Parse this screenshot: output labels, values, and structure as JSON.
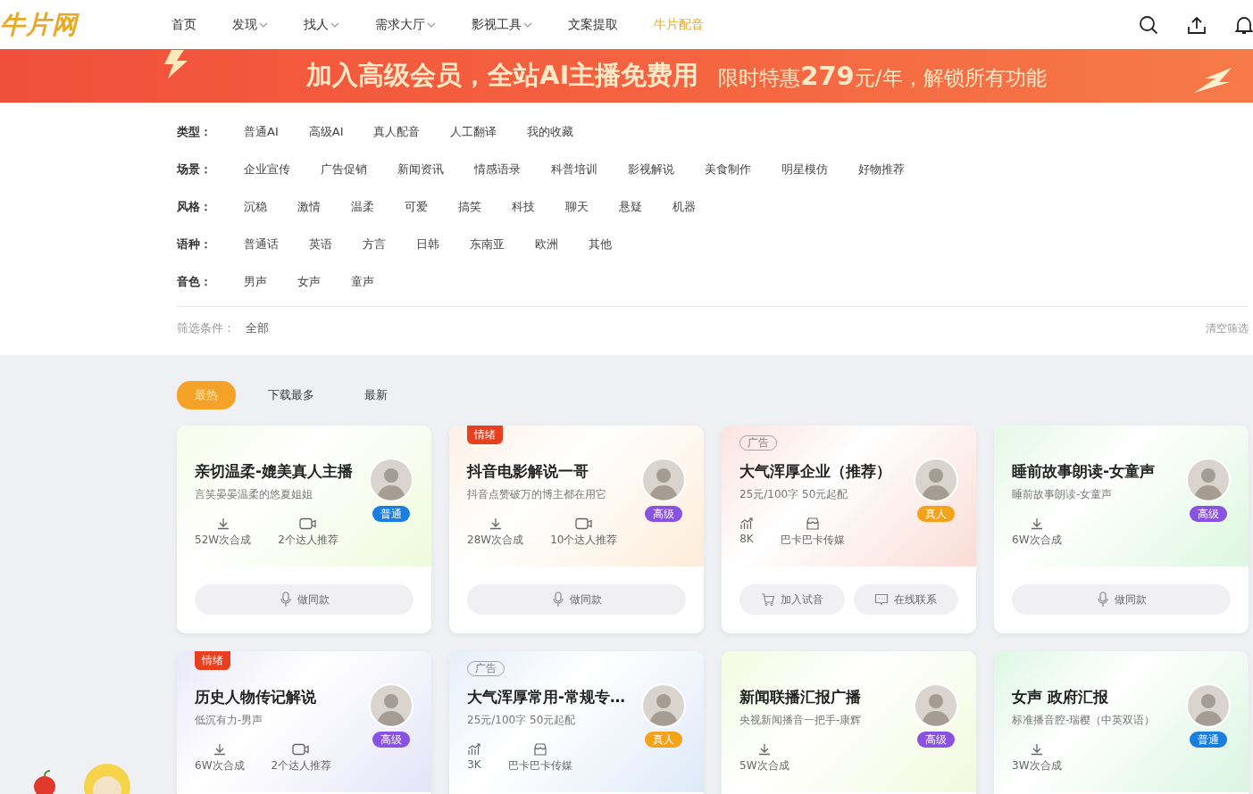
{
  "header": {
    "logo": "牛片网",
    "nav": [
      {
        "label": "首页",
        "dropdown": false,
        "selected": false
      },
      {
        "label": "发现",
        "dropdown": true,
        "selected": false
      },
      {
        "label": "找人",
        "dropdown": true,
        "selected": false
      },
      {
        "label": "需求大厅",
        "dropdown": true,
        "selected": false
      },
      {
        "label": "影视工具",
        "dropdown": true,
        "selected": false
      },
      {
        "label": "文案提取",
        "dropdown": false,
        "selected": false
      },
      {
        "label": "牛片配音",
        "dropdown": false,
        "selected": true
      }
    ]
  },
  "banner": {
    "headline": "加入高级会员，全站AI主播免费用",
    "offer": "限时特惠**279**元/年，解锁所有功能"
  },
  "filters": {
    "groups": [
      {
        "label": "类型：",
        "options": [
          {
            "label": "普通AI",
            "selected": false
          },
          {
            "label": "高级AI",
            "selected": false
          },
          {
            "label": "真人配音",
            "selected": false
          },
          {
            "label": "人工翻译",
            "selected": false
          },
          {
            "label": "我的收藏",
            "selected": false
          }
        ]
      },
      {
        "label": "场景：",
        "options": [
          {
            "label": "企业宣传",
            "selected": false
          },
          {
            "label": "广告促销",
            "selected": false
          },
          {
            "label": "新闻资讯",
            "selected": false
          },
          {
            "label": "情感语录",
            "selected": false
          },
          {
            "label": "科普培训",
            "selected": false
          },
          {
            "label": "影视解说",
            "selected": false
          },
          {
            "label": "美食制作",
            "selected": false
          },
          {
            "label": "明星模仿",
            "selected": false
          },
          {
            "label": "好物推荐",
            "selected": false
          }
        ]
      },
      {
        "label": "风格：",
        "options": [
          {
            "label": "沉稳",
            "selected": false
          },
          {
            "label": "激情",
            "selected": false
          },
          {
            "label": "温柔",
            "selected": false
          },
          {
            "label": "可爱",
            "selected": false
          },
          {
            "label": "搞笑",
            "selected": false
          },
          {
            "label": "科技",
            "selected": false
          },
          {
            "label": "聊天",
            "selected": false
          },
          {
            "label": "悬疑",
            "selected": false
          },
          {
            "label": "机器",
            "selected": false
          }
        ]
      },
      {
        "label": "语种：",
        "options": [
          {
            "label": "普通话",
            "selected": false
          },
          {
            "label": "英语",
            "selected": false
          },
          {
            "label": "方言",
            "selected": false
          },
          {
            "label": "日韩",
            "selected": false
          },
          {
            "label": "东南亚",
            "selected": false
          },
          {
            "label": "欧洲",
            "selected": false
          },
          {
            "label": "其他",
            "selected": false
          }
        ]
      },
      {
        "label": "音色：",
        "options": [
          {
            "label": "男声",
            "selected": false
          },
          {
            "label": "女声",
            "selected": false
          },
          {
            "label": "童声",
            "selected": false
          }
        ]
      }
    ],
    "conditions_label": "筛选条件：",
    "conditions_value": "全部",
    "clear": "清空筛选"
  },
  "sort_tabs": [
    {
      "label": "最热",
      "selected": true
    },
    {
      "label": "下载最多",
      "selected": false
    },
    {
      "label": "最新",
      "selected": false
    }
  ],
  "cards": [
    {
      "title": "亲切温柔-媲美真人主播",
      "subtitle": "言笑晏晏温柔的悠夏姐姐",
      "badge": {
        "label": "普通",
        "color": "#1a7ee0"
      },
      "stats": [
        {
          "kind": "download",
          "text": "52W次合成"
        },
        {
          "kind": "video",
          "text": "2个达人推荐"
        }
      ],
      "actions": [
        {
          "kind": "mic",
          "label": "做同款"
        }
      ]
    },
    {
      "tag": {
        "kind": "emotion",
        "label": "情绪"
      },
      "title": "抖音电影解说一哥",
      "subtitle": "抖音点赞破万的博主都在用它",
      "badge": {
        "label": "高级",
        "color": "#8a52e0"
      },
      "stats": [
        {
          "kind": "download",
          "text": "28W次合成"
        },
        {
          "kind": "video",
          "text": "10个达人推荐"
        }
      ],
      "actions": [
        {
          "kind": "mic",
          "label": "做同款"
        }
      ]
    },
    {
      "tag": {
        "kind": "ad",
        "label": "广告"
      },
      "title": "大气浑厚企业（推荐）",
      "subtitle": "25元/100字 50元起配",
      "badge": {
        "label": "真人",
        "color": "#f3a21a"
      },
      "stats": [
        {
          "kind": "chart",
          "text": "8K"
        },
        {
          "kind": "shop",
          "text": "巴卡巴卡传媒"
        }
      ],
      "actions": [
        {
          "kind": "cart",
          "label": "加入试音"
        },
        {
          "kind": "chat",
          "label": "在线联系"
        }
      ]
    },
    {
      "title": "睡前故事朗读-女童声",
      "subtitle": "睡前故事朗读-女童声",
      "badge": {
        "label": "高级",
        "color": "#8a52e0"
      },
      "stats": [
        {
          "kind": "download",
          "text": "6W次合成"
        }
      ],
      "actions": [
        {
          "kind": "mic",
          "label": "做同款"
        }
      ]
    },
    {
      "tag": {
        "kind": "emotion",
        "label": "情绪"
      },
      "title": "历史人物传记解说",
      "subtitle": "低沉有力-男声",
      "badge": {
        "label": "高级",
        "color": "#8a52e0"
      },
      "stats": [
        {
          "kind": "download",
          "text": "6W次合成"
        },
        {
          "kind": "video",
          "text": "2个达人推荐"
        }
      ]
    },
    {
      "tag": {
        "kind": "ad",
        "label": "广告"
      },
      "title": "大气浑厚常用-常规专…",
      "subtitle": "25元/100字 50元起配",
      "badge": {
        "label": "真人",
        "color": "#f3a21a"
      },
      "stats": [
        {
          "kind": "chart",
          "text": "3K"
        },
        {
          "kind": "shop",
          "text": "巴卡巴卡传媒"
        }
      ]
    },
    {
      "title": "新闻联播汇报广播",
      "subtitle": "央视新闻播音一把手-康辉",
      "badge": {
        "label": "高级",
        "color": "#8a52e0"
      },
      "stats": [
        {
          "kind": "download",
          "text": "5W次合成"
        }
      ]
    },
    {
      "title": "女声 政府汇报",
      "subtitle": "标准播音腔-瑞樱（中英双语）",
      "badge": {
        "label": "普通",
        "color": "#1a7ee0"
      },
      "stats": [
        {
          "kind": "download",
          "text": "3W次合成"
        }
      ]
    }
  ]
}
